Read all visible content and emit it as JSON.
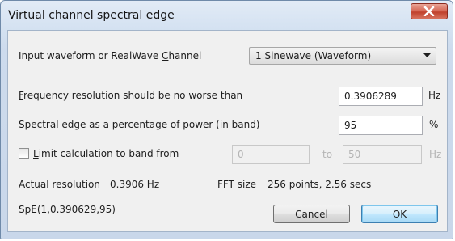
{
  "window": {
    "title": "Virtual channel spectral edge",
    "close_icon": "close-icon"
  },
  "input_row": {
    "label_pre": "Input waveform or RealWave ",
    "label_ul": "C",
    "label_post": "hannel",
    "selected": "1 Sinewave (Waveform)"
  },
  "freq_row": {
    "label_ul": "F",
    "label_post": "requency resolution should be no worse than",
    "value": "0.3906289",
    "unit": "Hz"
  },
  "edge_row": {
    "label_ul": "S",
    "label_post": "pectral edge as a percentage of power (in band)",
    "value": "95",
    "unit": "%"
  },
  "band_row": {
    "checkbox_checked": false,
    "label_ul": "L",
    "label_post": "imit calculation to band from",
    "from_value": "0",
    "to_label": "to",
    "to_value": "50",
    "unit": "Hz"
  },
  "info": {
    "actual_resolution_label": "Actual resolution",
    "actual_resolution_value": "0.3906 Hz",
    "fft_label": "FFT size",
    "fft_value": "256 points, 2.56 secs"
  },
  "expression": "SpE(1,0.390629,95)",
  "buttons": {
    "cancel": "Cancel",
    "ok": "OK"
  }
}
